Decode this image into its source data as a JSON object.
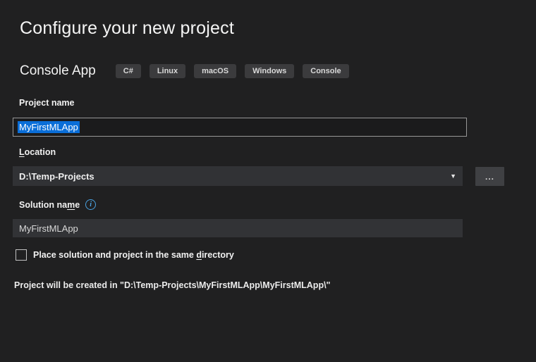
{
  "header": {
    "title": "Configure your new project"
  },
  "template": {
    "name": "Console App",
    "tags": [
      "C#",
      "Linux",
      "macOS",
      "Windows",
      "Console"
    ]
  },
  "fields": {
    "project_name": {
      "label": "Project name",
      "value": "MyFirstMLApp",
      "value_selected": true
    },
    "location": {
      "label_pre": "",
      "label_accel": "L",
      "label_post": "ocation",
      "value": "D:\\Temp-Projects",
      "caret": "▼",
      "browse_label": "..."
    },
    "solution_name": {
      "label_pre": "Solution na",
      "label_accel": "m",
      "label_post": "e",
      "info_glyph": "i",
      "value": "MyFirstMLApp"
    }
  },
  "checkbox": {
    "label_pre": "Place solution and project in the same ",
    "label_accel": "d",
    "label_post": "irectory",
    "checked": false
  },
  "footer": {
    "text": "Project will be created in \"D:\\Temp-Projects\\MyFirstMLApp\\MyFirstMLApp\\\""
  },
  "colors": {
    "selection_blue": "#0a6ed8",
    "info_icon_blue": "#4aa3e3",
    "background": "#202021"
  }
}
